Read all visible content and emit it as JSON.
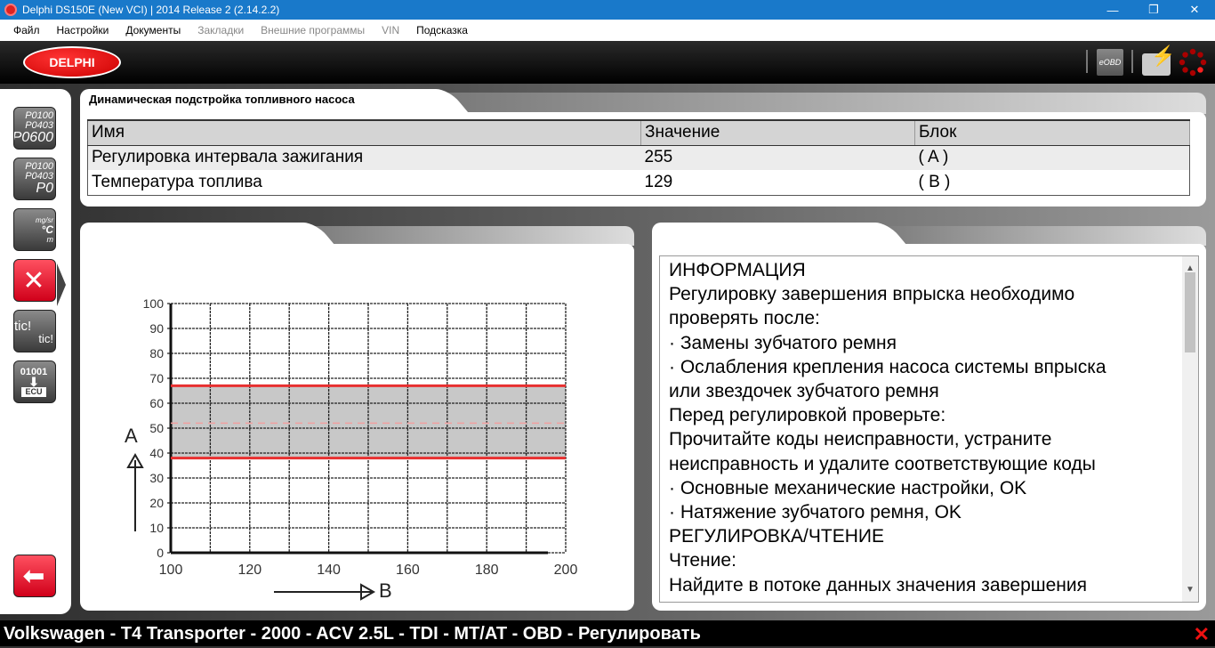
{
  "window": {
    "title": "Delphi DS150E (New VCI) | 2014 Release 2 (2.14.2.2)"
  },
  "menu": [
    {
      "label": "Файл",
      "enabled": true
    },
    {
      "label": "Настройки",
      "enabled": true
    },
    {
      "label": "Документы",
      "enabled": true
    },
    {
      "label": "Закладки",
      "enabled": false
    },
    {
      "label": "Внешние программы",
      "enabled": false
    },
    {
      "label": "VIN",
      "enabled": false
    },
    {
      "label": "Подсказка",
      "enabled": true
    }
  ],
  "header": {
    "logo": "DELPHI",
    "eobd": "eOBD",
    "icons": [
      "eobd-icon",
      "battery-icon",
      "loading-spinner-icon"
    ]
  },
  "sidebar": {
    "btn1": [
      "P0100",
      "P0403",
      "P0600"
    ],
    "btn2": [
      "P0100",
      "P0403",
      "P0"
    ],
    "btn3": [
      "mg/sr",
      "°C",
      "m"
    ],
    "btn5": [
      "tic!",
      "tic!"
    ],
    "btn6": [
      "01001",
      "ECU"
    ]
  },
  "top_panel": {
    "title": "Динамическая подстройка топливного насоса",
    "columns": [
      "Имя",
      "Значение",
      "Блок"
    ],
    "rows": [
      [
        "Регулировка интервала зажигания",
        "255",
        "( A )"
      ],
      [
        "Температура топлива",
        "129",
        "( B )"
      ]
    ]
  },
  "chart_data": {
    "type": "area",
    "xlabel": "B",
    "ylabel": "A",
    "xlim": [
      100,
      200
    ],
    "ylim": [
      0,
      100
    ],
    "xticks": [
      100,
      120,
      140,
      160,
      180,
      200
    ],
    "yticks": [
      0,
      10,
      20,
      30,
      40,
      50,
      60,
      70,
      80,
      90,
      100
    ],
    "grid": true,
    "band": {
      "lower": 38,
      "upper": 67,
      "center": 52
    },
    "colors": {
      "band_line": "#e83030",
      "band_fill": "#c8c8c8"
    }
  },
  "info": {
    "lines": [
      " ИНФОРМАЦИЯ",
      "Регулировку завершения впрыска необходимо",
      "проверять после:",
      "· Замены зубчатого ремня",
      "· Ослабления крепления насоса системы впрыска",
      "или звездочек зубчатого ремня",
      "Перед регулировкой проверьте:",
      "Прочитайте коды неисправности, устраните",
      "неисправность и удалите соответствующие коды",
      "· Основные механические настройки, OK",
      "· Натяжение зубчатого ремня, OK",
      "РЕГУЛИРОВКА/ЧТЕНИЕ",
      "Чтение:",
      "Найдите в потоке данных значения завершения"
    ]
  },
  "status": {
    "text": "Volkswagen - T4 Transporter - 2000 - ACV 2.5L - TDI - MT/AT - OBD - Регулировать",
    "close": "✕"
  }
}
